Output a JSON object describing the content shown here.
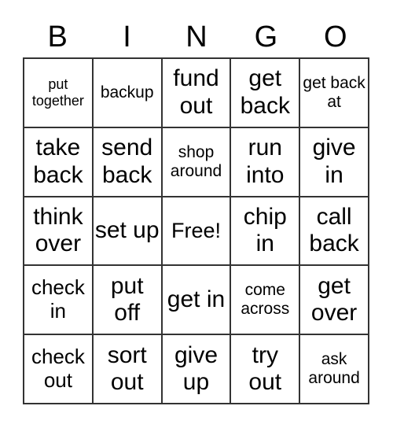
{
  "header": [
    "B",
    "I",
    "N",
    "G",
    "O"
  ],
  "cells": [
    "put together",
    "backup",
    "fund out",
    "get back",
    "get back at",
    "take back",
    "send back",
    "shop around",
    "run into",
    "give in",
    "think over",
    "set up",
    "Free!",
    "chip in",
    "call back",
    "check in",
    "put off",
    "get in",
    "come across",
    "get over",
    "check out",
    "sort out",
    "give up",
    "try out",
    "ask around"
  ]
}
